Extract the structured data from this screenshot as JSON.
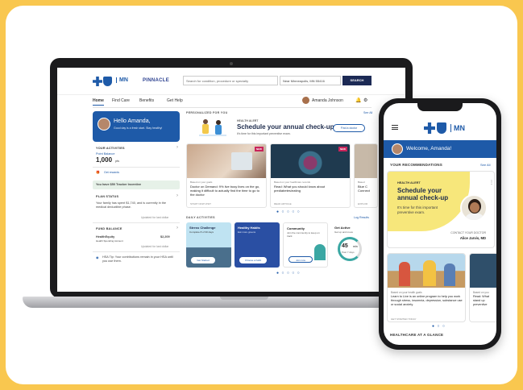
{
  "laptop": {
    "brand_mn": "MN",
    "brand_pinnacle": "PINNACLE",
    "search_placeholder": "Search for condition, procedure or specialty",
    "location": "Near Minneapolis, MN 55416",
    "search_button": "SEARCH",
    "nav": [
      "Home",
      "Find Care",
      "Benefits",
      "Get Help"
    ],
    "user_name": "Amanda Johnson",
    "hello": "Hello Amanda,",
    "hello_sub": "Good day is a fresh start. Stay healthy!",
    "your_activities": "YOUR ACTIVITIES",
    "points_label": "Point Balance",
    "points_value": "1,000",
    "points_unit": "pts",
    "rewards": "Get rewards",
    "promo": "You have $50 Tracker Incentive",
    "plan_status": "PLAN STATUS",
    "plan_text": "Your family has spent $1,740, and is currently in the medical deductible phase.",
    "plan_link": "Updated for last dollar",
    "fund_balance": "FUND BALANCE",
    "fund_name": "HealthEquity",
    "fund_sub": "Health Spending Account",
    "fund_value": "$2,209",
    "fund_link": "Updated for last dollar",
    "hsa_tip": "HSA Tip: Your contributions remain in your HSA until you use them.",
    "personalized": "PERSONALIZED FOR YOU",
    "see_all": "See All",
    "alert_label": "HEALTH ALERT",
    "alert_title": "Schedule your annual check-up",
    "alert_sub": "It's time for this important preventive exam.",
    "alert_button": "Find a doctor",
    "cards": [
      {
        "eyebrow": "Based on your goals",
        "text": "Doctor on Demand: 9% live busy lives on the go, making it difficult to actually find the time to go to the doctor",
        "foot": "START NOW VISIT",
        "tag": "NEW"
      },
      {
        "eyebrow": "Based on your healthcare records",
        "text": "Read: What you should know about prediabetes/eating",
        "foot": "READ ARTICLE",
        "tag": "NEW"
      },
      {
        "eyebrow": "Based",
        "text": "Blue C Connect",
        "foot": "EXPLOR",
        "tag": ""
      }
    ],
    "daily_activities": "DAILY ACTIVITIES",
    "log_results": "Log Results",
    "activities": [
      {
        "title": "Stress Challenge",
        "sub": "Complete 8 of 30 days",
        "button": "Get Started"
      },
      {
        "title": "Healthy Habits",
        "sub": "Eat more greens",
        "button": "Choose a habit"
      },
      {
        "title": "Community",
        "sub": "Join the community to keep on track",
        "button": "Join now"
      },
      {
        "title": "Get Active",
        "sub": "Get up and move",
        "ring_value": "45",
        "ring_unit": "min",
        "ring_sub": "Past 7 days"
      }
    ]
  },
  "phone": {
    "brand_mn": "MN",
    "welcome": "Welcome, Amanda!",
    "recommendations": "YOUR RECOMMENDATIONS",
    "see_all": "See All",
    "alert_label": "HEALTH ALERT",
    "alert_title": "Schedule your annual check-up",
    "alert_sub": "It's time for this important preventive exam.",
    "contact": "CONTACT YOUR DOCTOR",
    "doctor": "Alice Jarvis, MD",
    "card": {
      "eyebrow": "Based on your health goals",
      "text": "Learn to Live is an online program to help you work through stress, insomnia, depression, substance use or social anxiety.",
      "foot": "GET STARTED TODAY"
    },
    "card2": {
      "eyebrow": "Based on you",
      "text": "Read: What stand up preventive"
    },
    "glance": "HEALTHCARE AT A GLANCE"
  },
  "colors": {
    "brand_blue": "#1e5aa8",
    "alert_yellow": "#f7e77b",
    "navy": "#1c2a55",
    "background": "#F9C74F"
  }
}
